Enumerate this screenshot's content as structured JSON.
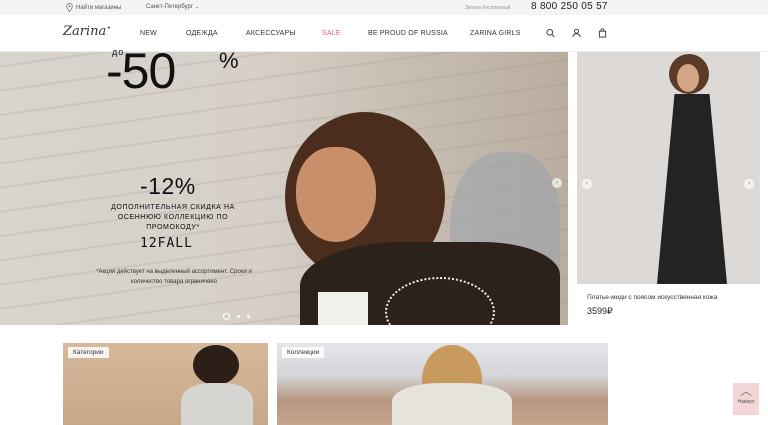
{
  "topbar": {
    "store_label": "Найти магазины",
    "city": "Санкт-Петербург",
    "free_call": "Звонок бесплатный",
    "phone": "8 800 250 05 57"
  },
  "header": {
    "logo": "Zarina",
    "nav": [
      "NEW",
      "ОДЕЖДА",
      "АКСЕССУАРЫ",
      "SALE",
      "BE PROUD OF RUSSIA",
      "ZARINA GIRLS"
    ],
    "icons": [
      "search-icon",
      "user-icon",
      "bag-icon"
    ]
  },
  "hero": {
    "do": "до",
    "discount": "-50",
    "percent": "%",
    "extra": "-12%",
    "desc": "ДОПОЛНИТЕЛЬНАЯ СКИДКА НА ОСЕННЮЮ КОЛЛЕКЦИЮ ПО ПРОМОКОДУ*",
    "code": "12FALL",
    "note": "*Акция действует на выделенный ассортимент. Сроки и количество товара ограничено"
  },
  "product": {
    "name": "Платье-миди с поясом искусственная кожа",
    "price": "3599₽"
  },
  "tiles": {
    "categories": "Категории",
    "collections": "Коллекции"
  },
  "to_top": "Наверх",
  "colors": {
    "sale": "#e0636b",
    "to_top_bg": "#f4d6d8"
  }
}
